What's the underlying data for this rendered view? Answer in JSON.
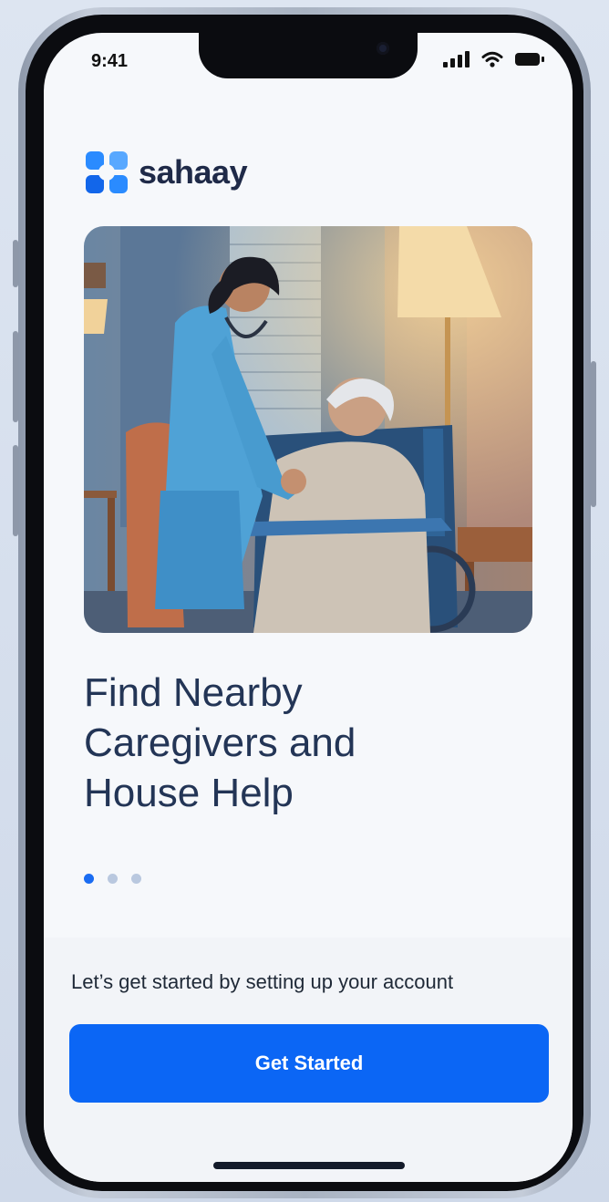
{
  "status_bar": {
    "time": "9:41"
  },
  "brand": {
    "name": "sahaay",
    "accent": "#1a6cf2"
  },
  "onboarding": {
    "headline_lines": [
      "Find Nearby",
      "Caregivers and",
      "House Help"
    ],
    "page_indicator": {
      "total": 3,
      "active": 1
    }
  },
  "footer": {
    "prompt": "Let’s get started by setting up your account",
    "cta_label": "Get Started"
  }
}
